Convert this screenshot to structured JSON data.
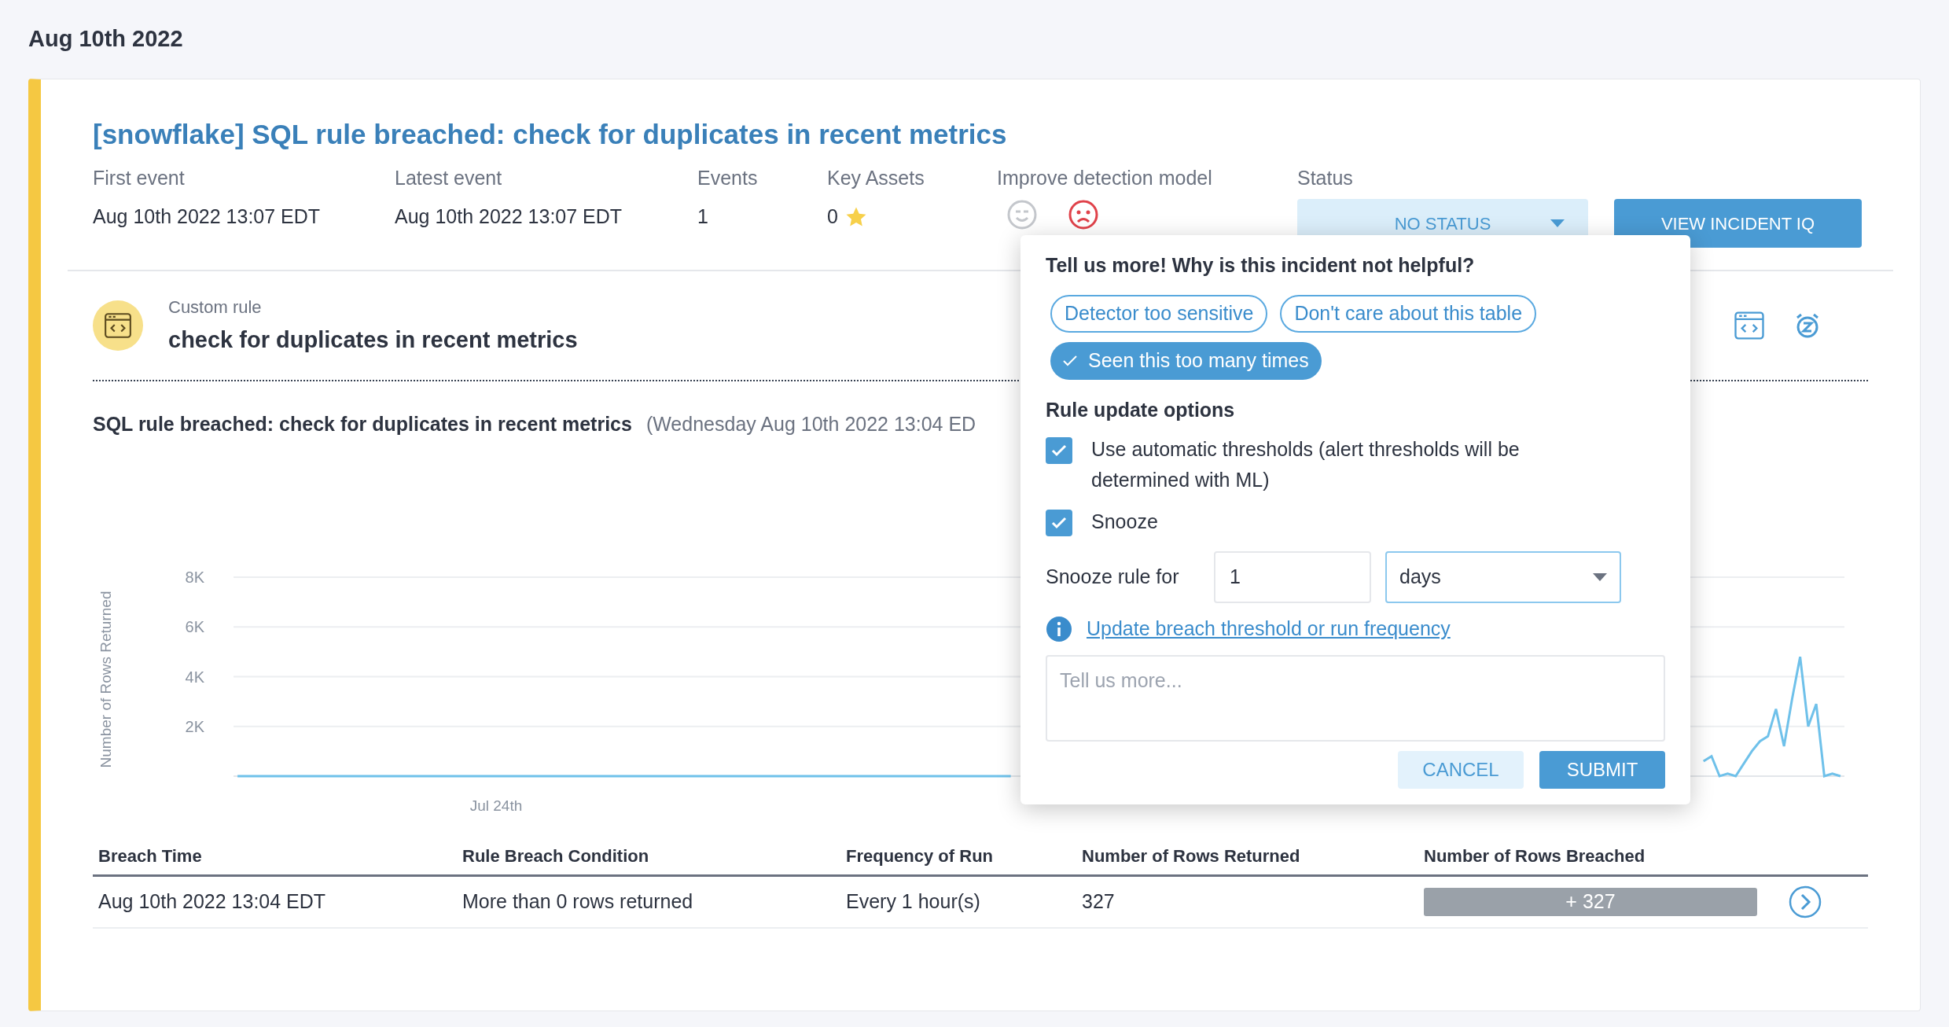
{
  "date_heading": "Aug 10th 2022",
  "incident": {
    "title": "[snowflake] SQL rule breached: check for duplicates in recent metrics",
    "fields": [
      {
        "label": "First event",
        "value": "Aug 10th 2022 13:07 EDT"
      },
      {
        "label": "Latest event",
        "value": "Aug 10th 2022 13:07 EDT"
      },
      {
        "label": "Events",
        "value": "1"
      }
    ],
    "key_assets": {
      "label": "Key Assets",
      "value": "0"
    },
    "feedback": {
      "label": "Improve detection model",
      "options": [
        {
          "kind": "helpful",
          "selected": false
        },
        {
          "kind": "not_helpful",
          "selected": true
        }
      ]
    },
    "status": {
      "label": "Status",
      "value": "NO STATUS"
    },
    "view_button": "VIEW INCIDENT IQ"
  },
  "rule": {
    "type": "Custom rule",
    "name": "check for duplicates in recent metrics"
  },
  "chart": {
    "title": "SQL rule breached: check for duplicates in recent metrics",
    "subtitle": "(Wednesday Aug 10th 2022 13:04 ED",
    "chart_data": {
      "type": "line",
      "ylabel": "Number of Rows Returned",
      "grid": true,
      "ylim": [
        0,
        8000
      ],
      "annotations": [
        "Jul 24th"
      ],
      "yticks": [
        {
          "value": 8000,
          "label": "8K"
        },
        {
          "value": 6000,
          "label": "6K"
        },
        {
          "value": 4000,
          "label": "4K"
        },
        {
          "value": 2000,
          "label": "2K"
        }
      ],
      "series": [
        {
          "color": "#6fc1ea",
          "values": [
            0,
            0,
            0,
            0,
            0,
            0,
            0,
            0,
            0,
            0,
            0,
            0,
            0,
            0,
            0,
            0,
            0,
            0,
            0,
            0,
            0,
            0,
            0,
            0,
            0,
            0,
            0,
            0,
            0,
            0,
            0,
            0,
            0,
            0,
            0,
            0,
            0,
            0,
            0,
            0,
            0,
            0,
            0,
            0,
            0,
            0,
            0,
            0,
            0,
            0,
            0,
            0,
            0,
            0,
            0,
            0,
            0,
            0,
            0,
            0,
            0,
            0,
            0,
            0,
            0,
            0,
            0,
            0,
            0,
            0,
            0,
            0,
            0,
            0,
            0,
            0,
            0,
            0,
            0,
            0,
            0,
            0,
            0,
            0,
            0,
            0,
            0,
            0,
            0,
            0,
            0,
            0,
            0,
            0,
            0,
            0,
            0,
            null,
            null,
            null,
            null,
            null,
            null,
            null,
            null,
            null,
            null,
            null,
            null,
            null,
            null,
            null,
            null,
            null,
            null,
            null,
            null,
            null,
            null,
            null,
            null,
            null,
            null,
            null,
            null,
            null,
            null,
            null,
            null,
            null,
            null,
            null,
            null,
            null,
            null,
            null,
            null,
            null,
            null,
            null,
            null,
            null,
            null,
            null,
            null,
            null,
            null,
            null,
            null,
            null,
            null,
            null,
            null,
            null,
            null,
            null,
            null,
            null,
            null,
            null,
            null,
            null,
            null,
            null,
            null,
            null,
            null,
            null,
            null,
            null,
            null,
            null,
            null,
            null,
            null,
            null,
            null,
            null,
            null,
            null,
            null,
            null,
            600,
            800,
            0,
            100,
            0,
            500,
            1000,
            1400,
            1600,
            2700,
            1200,
            3100,
            4800,
            2000,
            2900,
            0,
            100,
            0
          ]
        }
      ]
    }
  },
  "table": {
    "columns": [
      "Breach Time",
      "Rule Breach Condition",
      "Frequency of Run",
      "Number of Rows Returned",
      "Number of Rows Breached"
    ],
    "rows": [
      {
        "cells": [
          "Aug 10th 2022 13:04 EDT",
          "More than 0 rows returned",
          "Every 1 hour(s)",
          "327"
        ],
        "breached": "+ 327"
      }
    ]
  },
  "popup": {
    "title": "Tell us more! Why is this incident not helpful?",
    "reasons": [
      {
        "label": "Detector too sensitive",
        "selected": false
      },
      {
        "label": "Don't care about this table",
        "selected": false
      },
      {
        "label": "Seen this too many times",
        "selected": true
      }
    ],
    "section_title": "Rule update options",
    "options": [
      {
        "label": "Use automatic thresholds (alert thresholds will be determined with ML)",
        "checked": true
      },
      {
        "label": "Snooze",
        "checked": true
      }
    ],
    "snooze": {
      "label": "Snooze rule for",
      "value": "1",
      "unit": "days"
    },
    "link": "Update breach threshold or run frequency",
    "comment_placeholder": "Tell us more...",
    "cancel": "CANCEL",
    "submit": "SUBMIT"
  }
}
